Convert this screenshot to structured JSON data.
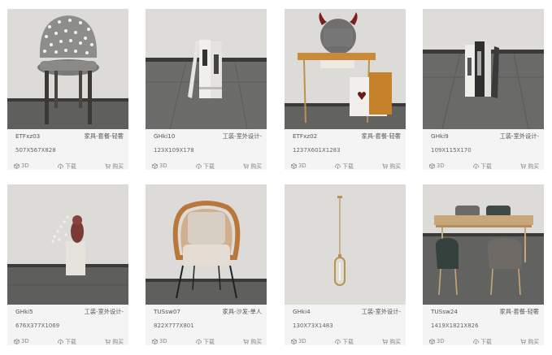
{
  "actions": {
    "d3": "3D",
    "download": "下载",
    "buy": "购买"
  },
  "items": [
    {
      "code": "ETFxz03",
      "category": "家具-套餐-轻奢",
      "dims": "507X567X828"
    },
    {
      "code": "GHki10",
      "category": "工装-室外设计-",
      "dims": "123X109X178"
    },
    {
      "code": "ETFxz02",
      "category": "家具-套餐-轻奢",
      "dims": "1237X601X1283"
    },
    {
      "code": "GHki9",
      "category": "工装-室外设计-",
      "dims": "109X115X170"
    },
    {
      "code": "GHki5",
      "category": "工装-室外设计-",
      "dims": "676X377X1069"
    },
    {
      "code": "TUSsw07",
      "category": "家具-沙发-单人",
      "dims": "822X777X801"
    },
    {
      "code": "GHki4",
      "category": "工装-室外设计-",
      "dims": "130X73X1483"
    },
    {
      "code": "TUSsw24",
      "category": "家具-套餐-轻奢",
      "dims": "1419X1821X826"
    }
  ]
}
